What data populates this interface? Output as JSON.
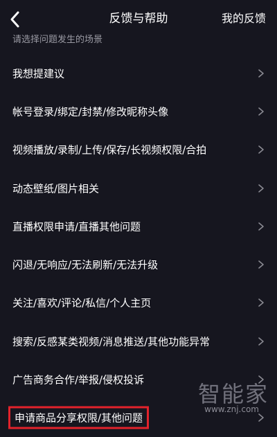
{
  "header": {
    "back_icon": "chevron-left-icon",
    "title": "反馈与帮助",
    "my_feedback": "我的反馈"
  },
  "section_hint": "请选择问题发生的场景",
  "items": [
    {
      "label": "我想提建议"
    },
    {
      "label": "帐号登录/绑定/封禁/修改昵称头像"
    },
    {
      "label": "视频播放/录制/上传/保存/长视频权限/合拍"
    },
    {
      "label": "动态壁纸/图片相关"
    },
    {
      "label": "直播权限申请/直播其他问题"
    },
    {
      "label": "闪退/无响应/无法刷新/无法升级"
    },
    {
      "label": "关注/喜欢/评论/私信/个人主页"
    },
    {
      "label": "搜索/反感某类视频/消息推送/其他功能异常"
    },
    {
      "label": "广告商务合作/举报/侵权投诉"
    },
    {
      "label": "申请商品分享权限/其他问题",
      "highlighted": true
    }
  ],
  "watermark": {
    "brand": "智能家",
    "url": "www.znj.com"
  },
  "colors": {
    "background": "#16161f",
    "highlight_border": "#e3222b",
    "chevron": "#8a8a92"
  }
}
